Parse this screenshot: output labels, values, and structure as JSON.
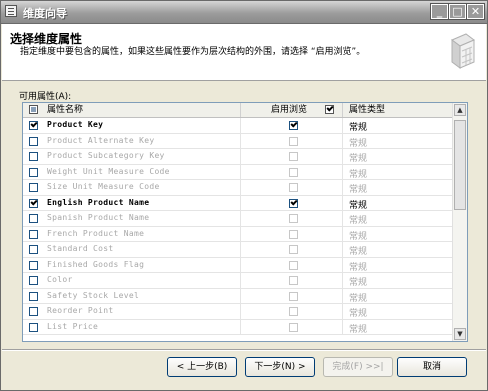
{
  "window": {
    "title": "维度向导"
  },
  "header": {
    "title": "选择维度属性",
    "description": "指定维度中要包含的属性，如果这些属性要作为层次结构的外围，请选择 “启用浏览”。"
  },
  "available_label": "可用属性(A):",
  "grid": {
    "columns": [
      "属性名称",
      "启用浏览",
      "属性类型"
    ],
    "rows": [
      {
        "name": "Product Key",
        "checked": true,
        "browse": true,
        "type": "常规"
      },
      {
        "name": "Product Alternate Key",
        "checked": false,
        "browse": false,
        "type": "常规"
      },
      {
        "name": "Product Subcategory Key",
        "checked": false,
        "browse": false,
        "type": "常规"
      },
      {
        "name": "Weight Unit Measure Code",
        "checked": false,
        "browse": false,
        "type": "常规"
      },
      {
        "name": "Size Unit Measure Code",
        "checked": false,
        "browse": false,
        "type": "常规"
      },
      {
        "name": "English Product Name",
        "checked": true,
        "browse": true,
        "type": "常规"
      },
      {
        "name": "Spanish Product Name",
        "checked": false,
        "browse": false,
        "type": "常规"
      },
      {
        "name": "French Product Name",
        "checked": false,
        "browse": false,
        "type": "常规"
      },
      {
        "name": "Standard Cost",
        "checked": false,
        "browse": false,
        "type": "常规"
      },
      {
        "name": "Finished Goods Flag",
        "checked": false,
        "browse": false,
        "type": "常规"
      },
      {
        "name": "Color",
        "checked": false,
        "browse": false,
        "type": "常规"
      },
      {
        "name": "Safety Stock Level",
        "checked": false,
        "browse": false,
        "type": "常规"
      },
      {
        "name": "Reorder Point",
        "checked": false,
        "browse": false,
        "type": "常规"
      },
      {
        "name": "List Price",
        "checked": false,
        "browse": false,
        "type": "常规"
      }
    ]
  },
  "buttons": {
    "back": "< 上一步(B)",
    "next": "下一步(N) >",
    "finish": "完成(F) >>|",
    "cancel": "取消"
  },
  "title_buttons": {
    "minimize": "_",
    "maximize": "□",
    "close": "✕"
  }
}
